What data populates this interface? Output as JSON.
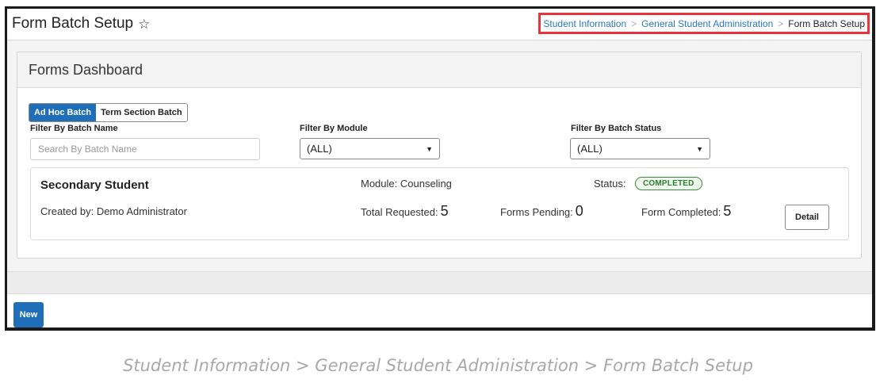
{
  "header": {
    "title": "Form Batch Setup",
    "favorite_icon": "star-outline-icon",
    "breadcrumb": [
      {
        "label": "Student Information"
      },
      {
        "label": "General Student Administration"
      },
      {
        "label": "Form Batch Setup"
      }
    ],
    "breadcrumb_separator": ">",
    "highlight_color": "#e8323c"
  },
  "dashboard": {
    "title": "Forms Dashboard",
    "batch_types": [
      {
        "label": "Ad Hoc Batch",
        "active": true
      },
      {
        "label": "Term Section Batch",
        "active": false
      }
    ],
    "filters": {
      "batch_name": {
        "label": "Filter By Batch Name",
        "placeholder": "Search By Batch Name",
        "value": ""
      },
      "module": {
        "label": "Filter By Module",
        "value": "(ALL)"
      },
      "batch_status": {
        "label": "Filter By Batch Status",
        "value": "(ALL)"
      }
    },
    "batches": [
      {
        "name": "Secondary Student",
        "created_by": "Created by: Demo Administrator",
        "module": "Module: Counseling",
        "status_label": "Status:",
        "status": "COMPLETED",
        "total_requested_label": "Total Requested:",
        "total_requested": "5",
        "forms_pending_label": "Forms Pending:",
        "forms_pending": "0",
        "form_completed_label": "Form Completed:",
        "form_completed": "5",
        "detail_label": "Detail"
      }
    ]
  },
  "footer": {
    "new_label": "New",
    "accent_color": "#1f6fb8"
  },
  "caption": "Student Information > General Student Administration > Form Batch Setup"
}
